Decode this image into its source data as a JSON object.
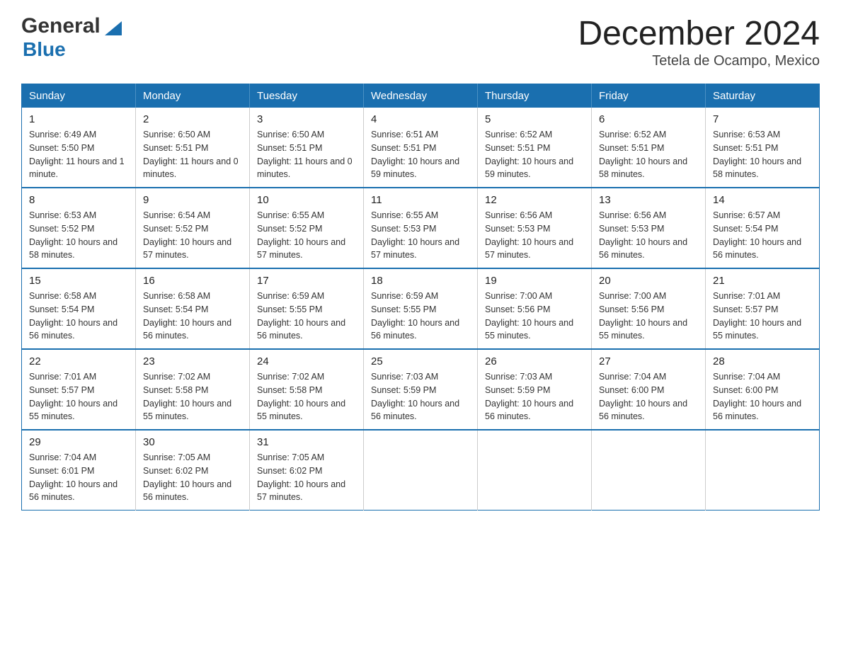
{
  "header": {
    "logo_general": "General",
    "logo_blue": "Blue",
    "title": "December 2024",
    "subtitle": "Tetela de Ocampo, Mexico"
  },
  "days_of_week": [
    "Sunday",
    "Monday",
    "Tuesday",
    "Wednesday",
    "Thursday",
    "Friday",
    "Saturday"
  ],
  "weeks": [
    [
      {
        "day": "1",
        "sunrise": "6:49 AM",
        "sunset": "5:50 PM",
        "daylight": "11 hours and 1 minute."
      },
      {
        "day": "2",
        "sunrise": "6:50 AM",
        "sunset": "5:51 PM",
        "daylight": "11 hours and 0 minutes."
      },
      {
        "day": "3",
        "sunrise": "6:50 AM",
        "sunset": "5:51 PM",
        "daylight": "11 hours and 0 minutes."
      },
      {
        "day": "4",
        "sunrise": "6:51 AM",
        "sunset": "5:51 PM",
        "daylight": "10 hours and 59 minutes."
      },
      {
        "day": "5",
        "sunrise": "6:52 AM",
        "sunset": "5:51 PM",
        "daylight": "10 hours and 59 minutes."
      },
      {
        "day": "6",
        "sunrise": "6:52 AM",
        "sunset": "5:51 PM",
        "daylight": "10 hours and 58 minutes."
      },
      {
        "day": "7",
        "sunrise": "6:53 AM",
        "sunset": "5:51 PM",
        "daylight": "10 hours and 58 minutes."
      }
    ],
    [
      {
        "day": "8",
        "sunrise": "6:53 AM",
        "sunset": "5:52 PM",
        "daylight": "10 hours and 58 minutes."
      },
      {
        "day": "9",
        "sunrise": "6:54 AM",
        "sunset": "5:52 PM",
        "daylight": "10 hours and 57 minutes."
      },
      {
        "day": "10",
        "sunrise": "6:55 AM",
        "sunset": "5:52 PM",
        "daylight": "10 hours and 57 minutes."
      },
      {
        "day": "11",
        "sunrise": "6:55 AM",
        "sunset": "5:53 PM",
        "daylight": "10 hours and 57 minutes."
      },
      {
        "day": "12",
        "sunrise": "6:56 AM",
        "sunset": "5:53 PM",
        "daylight": "10 hours and 57 minutes."
      },
      {
        "day": "13",
        "sunrise": "6:56 AM",
        "sunset": "5:53 PM",
        "daylight": "10 hours and 56 minutes."
      },
      {
        "day": "14",
        "sunrise": "6:57 AM",
        "sunset": "5:54 PM",
        "daylight": "10 hours and 56 minutes."
      }
    ],
    [
      {
        "day": "15",
        "sunrise": "6:58 AM",
        "sunset": "5:54 PM",
        "daylight": "10 hours and 56 minutes."
      },
      {
        "day": "16",
        "sunrise": "6:58 AM",
        "sunset": "5:54 PM",
        "daylight": "10 hours and 56 minutes."
      },
      {
        "day": "17",
        "sunrise": "6:59 AM",
        "sunset": "5:55 PM",
        "daylight": "10 hours and 56 minutes."
      },
      {
        "day": "18",
        "sunrise": "6:59 AM",
        "sunset": "5:55 PM",
        "daylight": "10 hours and 56 minutes."
      },
      {
        "day": "19",
        "sunrise": "7:00 AM",
        "sunset": "5:56 PM",
        "daylight": "10 hours and 55 minutes."
      },
      {
        "day": "20",
        "sunrise": "7:00 AM",
        "sunset": "5:56 PM",
        "daylight": "10 hours and 55 minutes."
      },
      {
        "day": "21",
        "sunrise": "7:01 AM",
        "sunset": "5:57 PM",
        "daylight": "10 hours and 55 minutes."
      }
    ],
    [
      {
        "day": "22",
        "sunrise": "7:01 AM",
        "sunset": "5:57 PM",
        "daylight": "10 hours and 55 minutes."
      },
      {
        "day": "23",
        "sunrise": "7:02 AM",
        "sunset": "5:58 PM",
        "daylight": "10 hours and 55 minutes."
      },
      {
        "day": "24",
        "sunrise": "7:02 AM",
        "sunset": "5:58 PM",
        "daylight": "10 hours and 55 minutes."
      },
      {
        "day": "25",
        "sunrise": "7:03 AM",
        "sunset": "5:59 PM",
        "daylight": "10 hours and 56 minutes."
      },
      {
        "day": "26",
        "sunrise": "7:03 AM",
        "sunset": "5:59 PM",
        "daylight": "10 hours and 56 minutes."
      },
      {
        "day": "27",
        "sunrise": "7:04 AM",
        "sunset": "6:00 PM",
        "daylight": "10 hours and 56 minutes."
      },
      {
        "day": "28",
        "sunrise": "7:04 AM",
        "sunset": "6:00 PM",
        "daylight": "10 hours and 56 minutes."
      }
    ],
    [
      {
        "day": "29",
        "sunrise": "7:04 AM",
        "sunset": "6:01 PM",
        "daylight": "10 hours and 56 minutes."
      },
      {
        "day": "30",
        "sunrise": "7:05 AM",
        "sunset": "6:02 PM",
        "daylight": "10 hours and 56 minutes."
      },
      {
        "day": "31",
        "sunrise": "7:05 AM",
        "sunset": "6:02 PM",
        "daylight": "10 hours and 57 minutes."
      },
      null,
      null,
      null,
      null
    ]
  ]
}
